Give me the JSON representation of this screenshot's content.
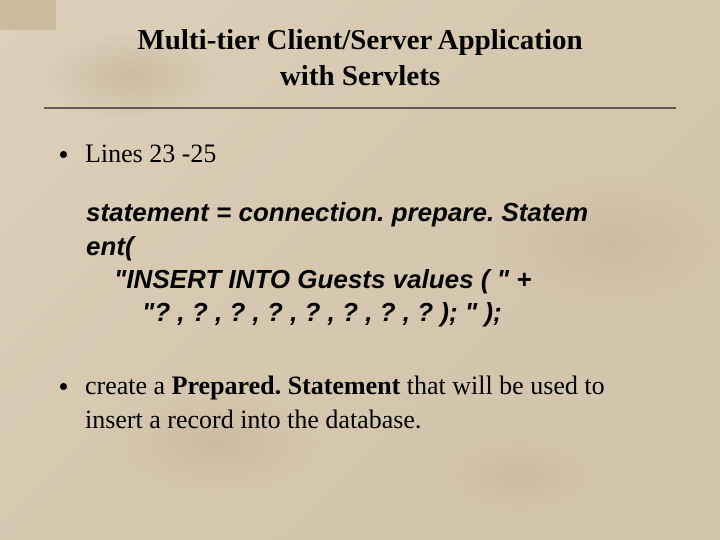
{
  "title": {
    "line1": "Multi-tier Client/Server Application",
    "line2": "with Servlets"
  },
  "bullets": {
    "b1": "Lines 23 -25",
    "b2_pre": "create a ",
    "b2_bold": "Prepared. Statement",
    "b2_post": " that will be used to insert a record into the database."
  },
  "code": {
    "l1": "statement = connection. prepare. Statem",
    "l2": "ent(",
    "l3": "\"INSERT INTO Guests values ( \" +",
    "l4": "\"? , ? , ? , ? , ? , ? , ? , ? ); \" );"
  }
}
